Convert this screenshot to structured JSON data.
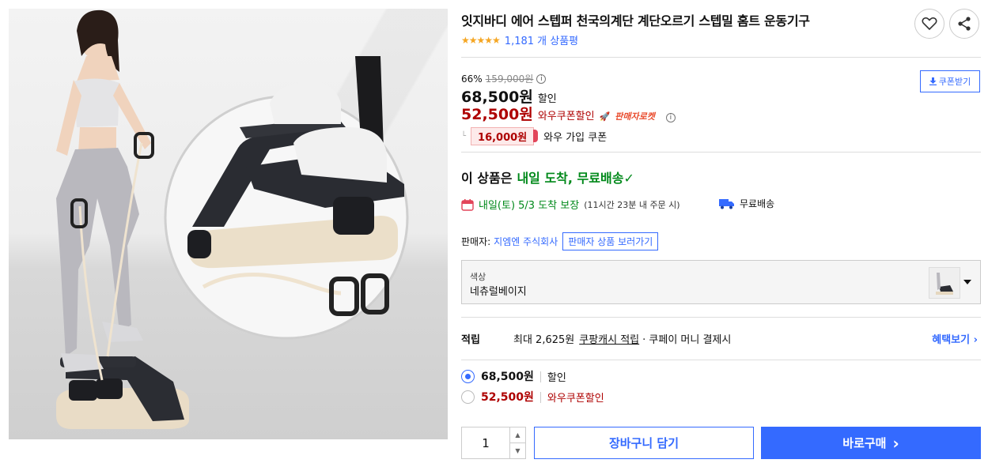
{
  "product": {
    "title": "잇지바디 에어 스텝퍼 천국의계단 계단오르기 스텝밀 홈트 운동기구",
    "stars": "★★★★★",
    "review_count": "1,181 개 상품평",
    "rating": 4.5
  },
  "price": {
    "discount_rate": "66%",
    "original_price": "159,000원",
    "sale_price": "68,500원",
    "sale_label": "할인",
    "wow_price": "52,500원",
    "wow_label": "와우쿠폰할인",
    "rocket_label": "판매자로켓",
    "coupon_amount": "16,000원",
    "coupon_desc": "와우 가입 쿠폰",
    "coupon_button": "쿠폰받기",
    "info_symbol": "i",
    "l_mark": "└"
  },
  "delivery": {
    "headline_prefix": "이 상품은",
    "headline_green": "내일 도착, 무료배송",
    "check": "✓",
    "arrival": "내일(토) 5/3 도착 보장",
    "cutoff": "(11시간 23분 내 주문 시)",
    "free_shipping": "무료배송"
  },
  "seller": {
    "label": "판매자:",
    "name": "지엠엔 주식회사",
    "more_button": "판매자 상품 보러가기"
  },
  "option": {
    "label": "색상",
    "value": "네츄럴베이지"
  },
  "points": {
    "label": "적립",
    "max": "최대 2,625원",
    "cash": "쿠팡캐시 적립",
    "rest": "· 쿠페이 머니 결제시",
    "benefit": "혜택보기 ›"
  },
  "payment_options": [
    {
      "price": "68,500원",
      "label": "할인",
      "selected": true
    },
    {
      "price": "52,500원",
      "label": "와우쿠폰할인",
      "selected": false
    }
  ],
  "purchase": {
    "quantity": "1",
    "up": "▲",
    "down": "▼",
    "cart": "장바구니 담기",
    "buy": "바로구매",
    "buy_arrow": "›"
  },
  "colors": {
    "accent": "#346aff",
    "wow_red": "#ae0000",
    "delivery_green": "#00891a",
    "star": "#f5a623"
  }
}
